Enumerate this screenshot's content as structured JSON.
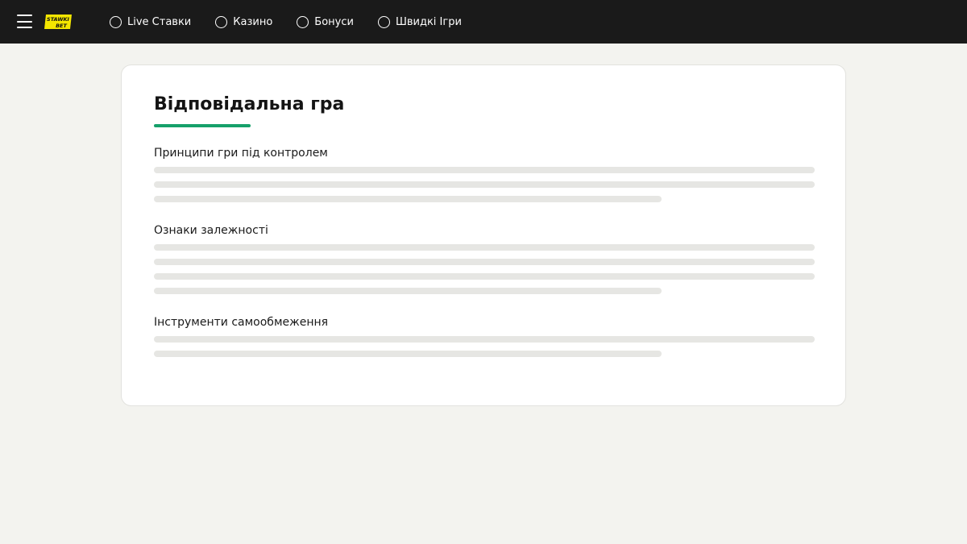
{
  "header": {
    "menu_icon": "hamburger-menu-icon",
    "logo": {
      "line1": "STAWKI",
      "line2": "BET",
      "color": "#f3e600"
    },
    "nav": [
      {
        "label": "Live Ставки",
        "icon": "circle-icon"
      },
      {
        "label": "Казино",
        "icon": "circle-icon"
      },
      {
        "label": "Бонуси",
        "icon": "circle-icon"
      },
      {
        "label": "Швидкі Ігри",
        "icon": "circle-icon"
      }
    ]
  },
  "content": {
    "title": "Відповідальна гра",
    "accent_color": "#16a06a",
    "sections": [
      {
        "heading": "Принципи гри під контролем"
      },
      {
        "heading": "Ознаки залежності"
      },
      {
        "heading": "Інструменти самообмеження"
      }
    ]
  }
}
